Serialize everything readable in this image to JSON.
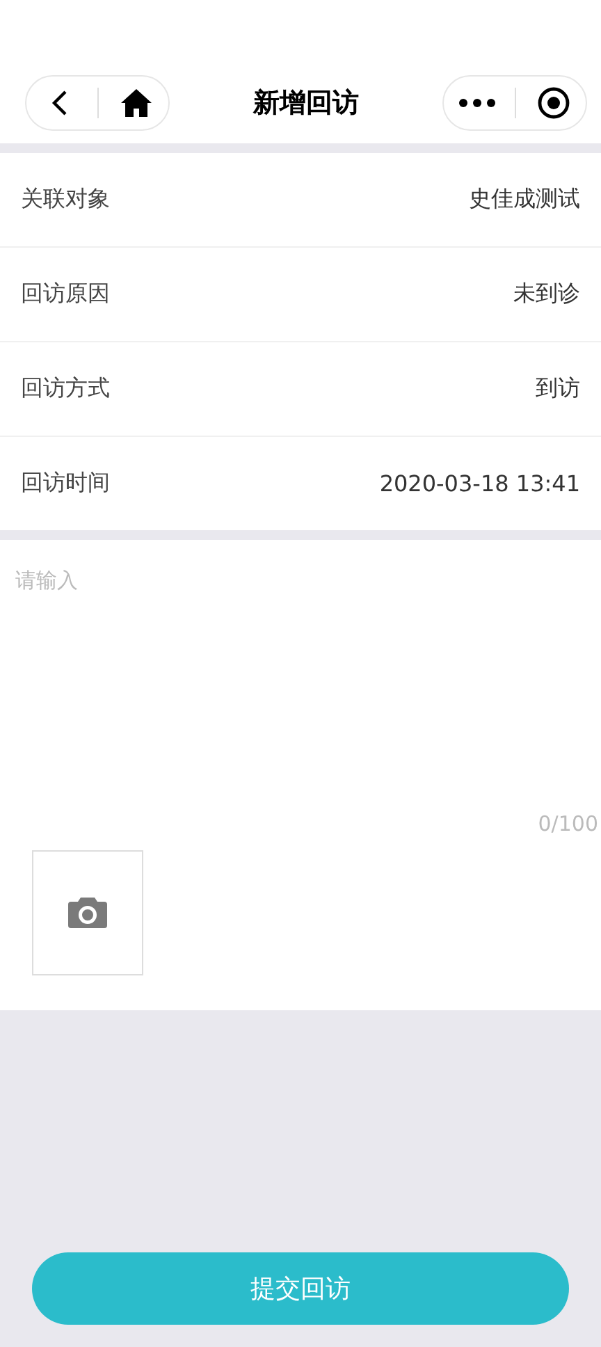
{
  "nav": {
    "title": "新增回访"
  },
  "fields": [
    {
      "label": "关联对象",
      "value": "史佳成测试"
    },
    {
      "label": "回访原因",
      "value": "未到诊"
    },
    {
      "label": "回访方式",
      "value": "到访"
    },
    {
      "label": "回访时间",
      "value": "2020-03-18 13:41"
    }
  ],
  "note": {
    "placeholder": "请输入",
    "counter": "0/100"
  },
  "submit": "提交回访"
}
